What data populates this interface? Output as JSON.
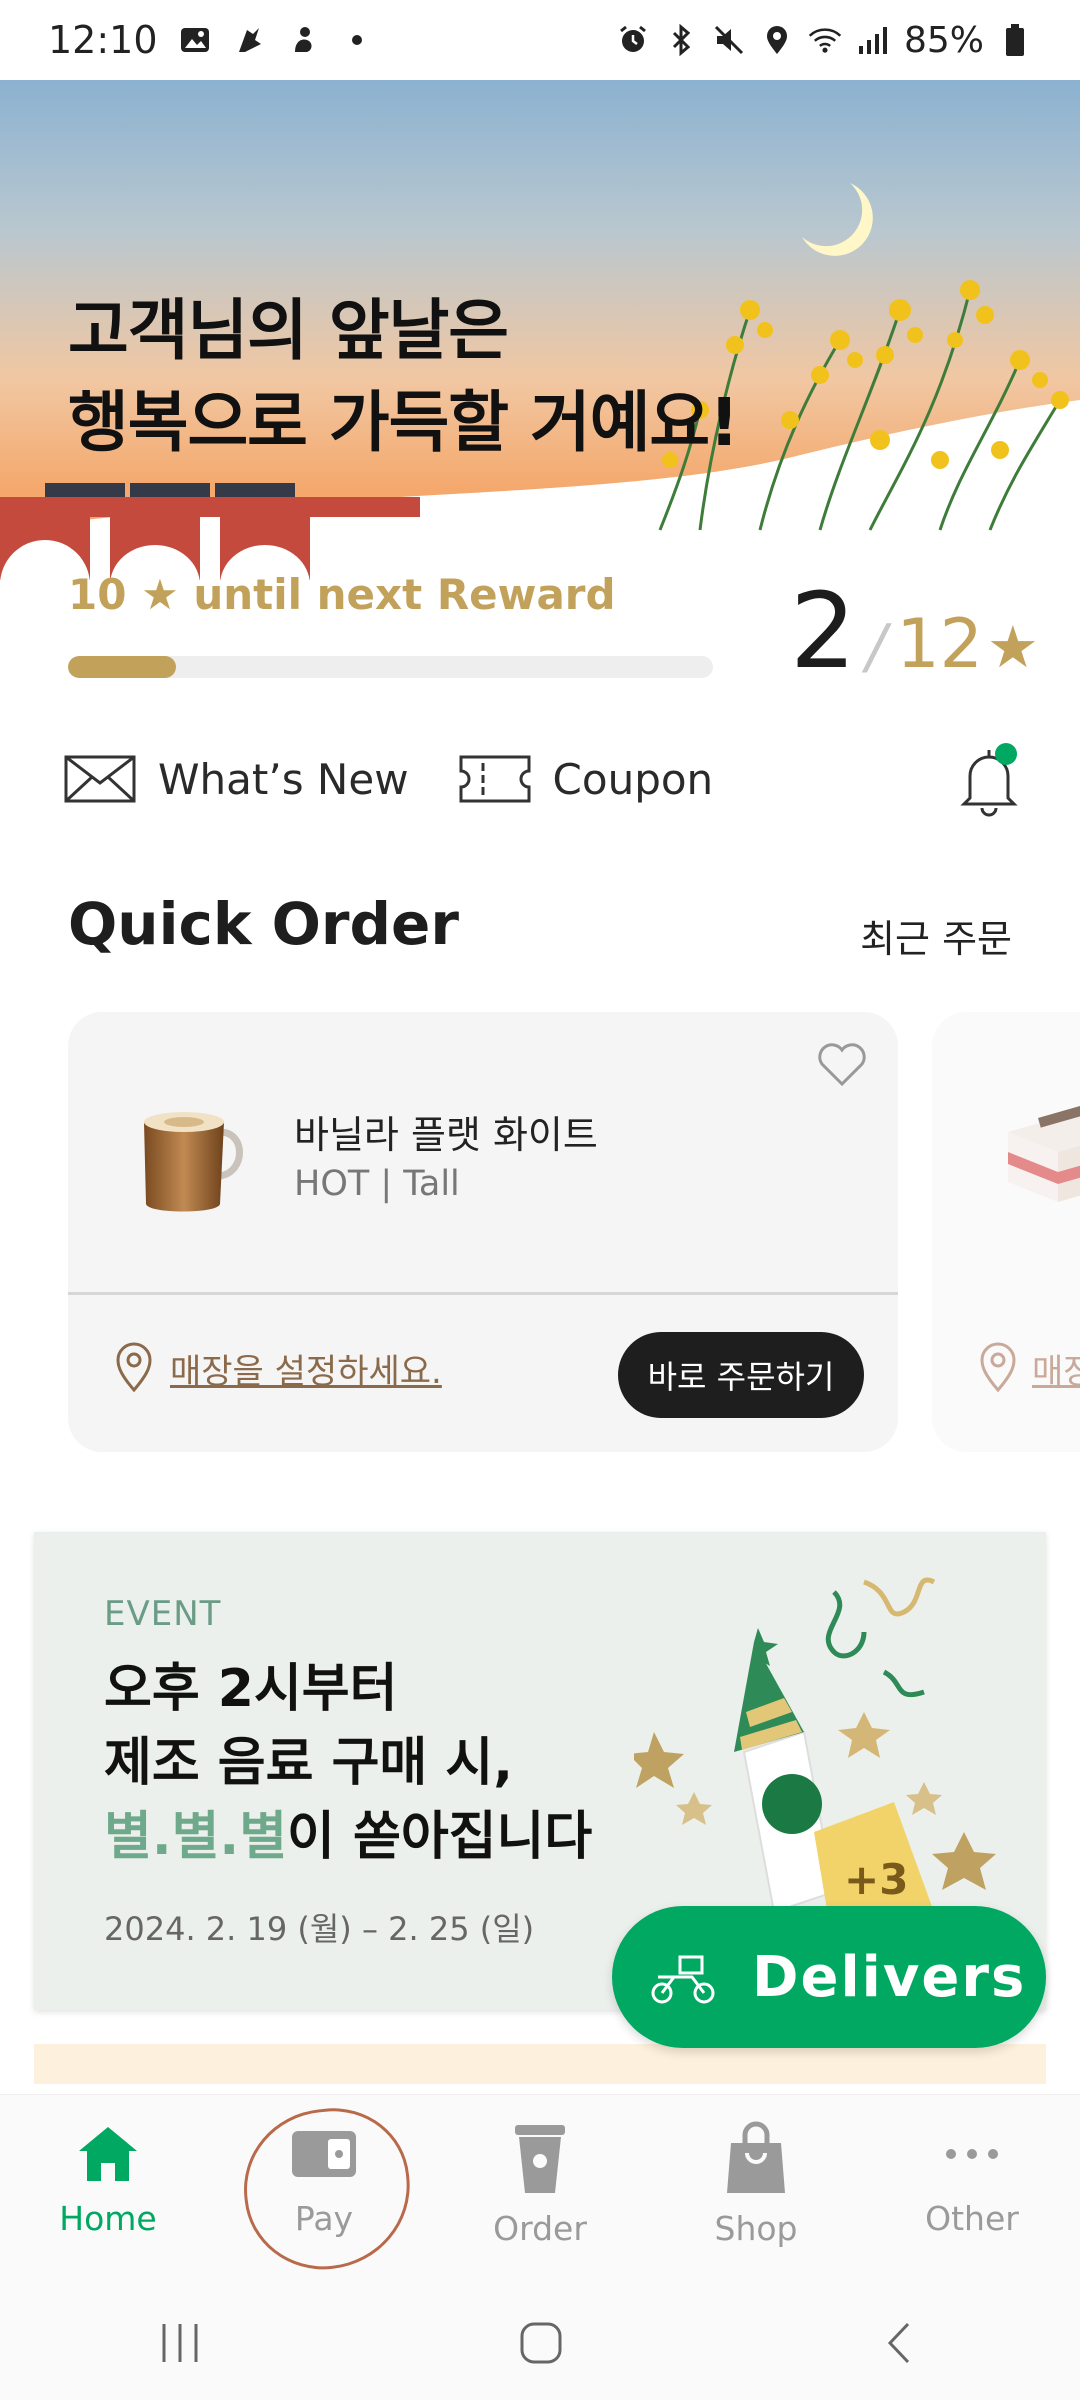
{
  "status_bar": {
    "time": "12:10",
    "battery": "85%",
    "icons_left": [
      "gallery-icon",
      "app-icon",
      "app-icon-2",
      "dot-icon"
    ],
    "icons_right": [
      "alarm-icon",
      "bluetooth-icon",
      "mute-icon",
      "location-icon",
      "wifi-icon",
      "signal-icon",
      "battery-icon"
    ]
  },
  "hero": {
    "line1": "고객님의 앞날은",
    "line2": "행복으로 가득할 거예요!"
  },
  "reward": {
    "stars_needed": "10",
    "label": "until next Reward",
    "current": "2",
    "total": "12",
    "progress": 0.167,
    "color": "#c2a25b"
  },
  "links": {
    "whats_new": "What’s New",
    "coupon": "Coupon"
  },
  "quick_order": {
    "title": "Quick Order",
    "recent_label": "최근 주문",
    "item": {
      "name": "바닐라 플랫 화이트",
      "options": "HOT | Tall",
      "store_prompt": "매장을 설정하세요.",
      "order_button": "바로 주문하기"
    },
    "peek_store_prompt": "매장"
  },
  "event": {
    "tag": "EVENT",
    "line1": "오후 2시부터",
    "line2": "제조 음료 구매 시,",
    "line3_highlight": "별.별.별",
    "line3_rest": "이 쏟아집니다",
    "date": "2024. 2. 19 (월) – 2. 25 (일)",
    "badge": "+3"
  },
  "deliver_button": "Delivers",
  "nav": {
    "items": [
      {
        "label": "Home",
        "icon": "home-icon"
      },
      {
        "label": "Pay",
        "icon": "pay-card-icon"
      },
      {
        "label": "Order",
        "icon": "cup-icon"
      },
      {
        "label": "Shop",
        "icon": "shopping-bag-icon"
      },
      {
        "label": "Other",
        "icon": "more-icon"
      }
    ],
    "active": "Home"
  },
  "colors": {
    "brand_green": "#00a862",
    "gold": "#c2a25b"
  }
}
